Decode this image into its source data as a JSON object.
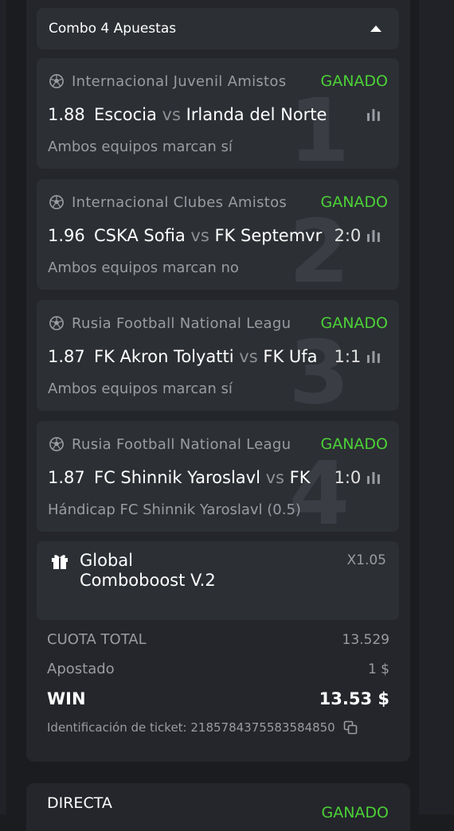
{
  "combo": {
    "title": "Combo 4 Apuestas",
    "collapse_icon": "caret-up-icon"
  },
  "bets": [
    {
      "number": "1",
      "league": "Internacional Juvenil Amistos",
      "status": "GANADO",
      "odds": "1.88",
      "home": "Escocia",
      "vs": "vs",
      "away": "Irlanda del Norte",
      "score": "",
      "market": "Ambos equipos marcan sí"
    },
    {
      "number": "2",
      "league": "Internacional Clubes Amistos",
      "status": "GANADO",
      "odds": "1.96",
      "home": "CSKA Sofia",
      "vs": "vs",
      "away": "FK Septemvr",
      "score": "2:0",
      "market": "Ambos equipos marcan no"
    },
    {
      "number": "3",
      "league": "Rusia Football National Leagu",
      "status": "GANADO",
      "odds": "1.87",
      "home": "FK Akron Tolyatti",
      "vs": "vs",
      "away": "FK Ufa",
      "score": "1:1",
      "market": "Ambos equipos marcan sí"
    },
    {
      "number": "4",
      "league": "Rusia Football National Leagu",
      "status": "GANADO",
      "odds": "1.87",
      "home": "FC Shinnik Yaroslavl",
      "vs": "vs",
      "away": "FK",
      "score": "1:0",
      "market": "Hándicap FC Shinnik Yaroslavl (0.5)"
    }
  ],
  "boost": {
    "name": "Global Comboboost V.2",
    "multiplier": "X1.05",
    "icon": "gift-icon"
  },
  "summary": {
    "total_odds_label": "CUOTA TOTAL",
    "total_odds_value": "13.529",
    "stake_label": "Apostado",
    "stake_value": "1 $",
    "win_label": "WIN",
    "win_value": "13.53 $",
    "ticket_label": "Identificación de ticket: 2185784375583584850"
  },
  "next_bet": {
    "title": "DIRECTA",
    "status": "GANADO"
  },
  "colors": {
    "won": "#4cd137",
    "card": "#2c2f34",
    "panel": "#24262b"
  }
}
